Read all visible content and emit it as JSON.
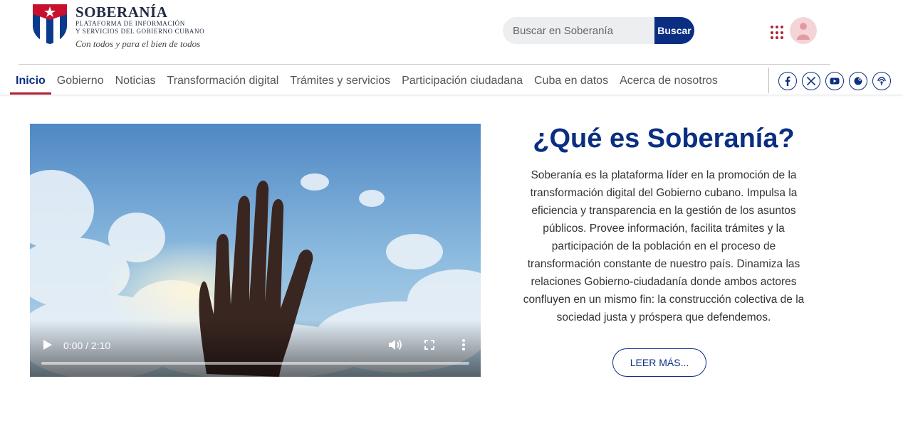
{
  "brand": {
    "title": "SOBERANÍA",
    "subtitle_line1": "PLATAFORMA DE INFORMACIÓN",
    "subtitle_line2": "Y SERVICIOS DEL GOBIERNO CUBANO",
    "slogan": "Con todos y para el bien de todos",
    "colors": {
      "primary": "#0a2e82",
      "accent": "#b32136"
    }
  },
  "search": {
    "placeholder": "Buscar en Soberanía",
    "button_label": "Buscar"
  },
  "header_icons": {
    "apps": "apps-grid-icon",
    "avatar": "user-avatar-icon"
  },
  "nav": {
    "items": [
      {
        "label": "Inicio",
        "active": true
      },
      {
        "label": "Gobierno"
      },
      {
        "label": "Noticias"
      },
      {
        "label": "Transformación digital"
      },
      {
        "label": "Trámites y servicios"
      },
      {
        "label": "Participación ciudadana"
      },
      {
        "label": "Cuba en datos"
      },
      {
        "label": "Acerca de nosotros"
      }
    ]
  },
  "social": [
    "facebook-icon",
    "x-twitter-icon",
    "youtube-icon",
    "mastodon-icon",
    "podcast-icon"
  ],
  "video": {
    "time": "0:00 / 2:10",
    "progress": 0
  },
  "about": {
    "title": "¿Qué es Soberanía?",
    "text": "Soberanía es la plataforma líder en la promoción de la transformación digital del Gobierno cubano. Impulsa la eficiencia y transparencia en la gestión de los asuntos públicos. Provee información, facilita trámites y la participación de la población en el proceso de transformación constante de nuestro país. Dinamiza las relaciones Gobierno-ciudadanía donde ambos actores confluyen en un mismo fin: la construcción colectiva de la sociedad justa y próspera que defendemos.",
    "button_label": "LEER MÁS..."
  }
}
